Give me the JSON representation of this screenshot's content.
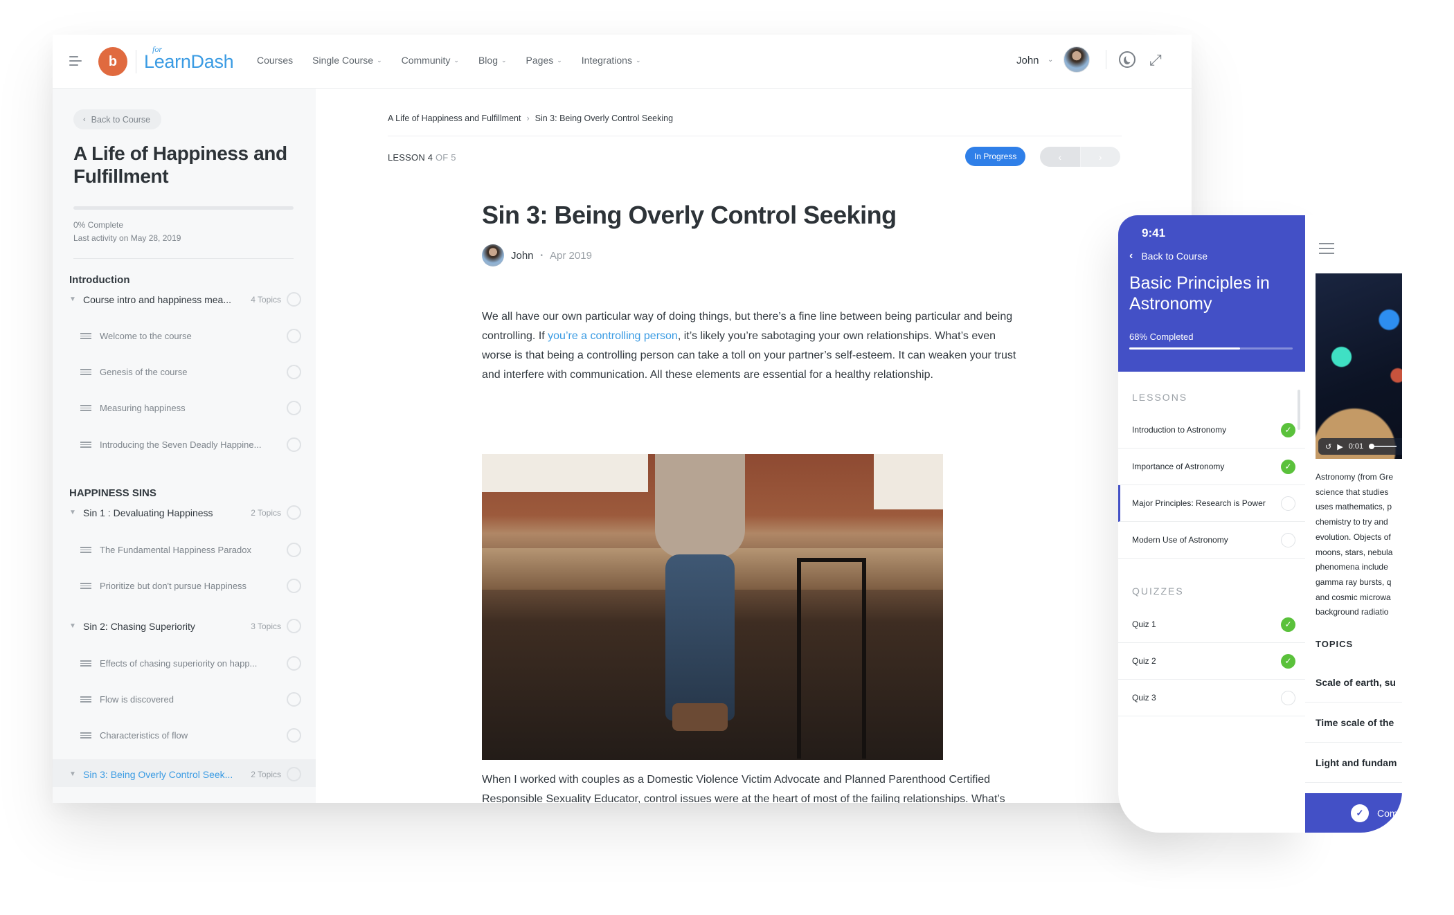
{
  "header": {
    "logo_mark": "b",
    "logo_for": "for",
    "logo_text": "LearnDash",
    "nav": [
      {
        "label": "Courses",
        "dropdown": false
      },
      {
        "label": "Single Course",
        "dropdown": true
      },
      {
        "label": "Community",
        "dropdown": true
      },
      {
        "label": "Blog",
        "dropdown": true
      },
      {
        "label": "Pages",
        "dropdown": true
      },
      {
        "label": "Integrations",
        "dropdown": true
      }
    ],
    "user_name": "John",
    "icons": [
      "menu-icon",
      "chevron-down-icon",
      "avatar",
      "dark-mode-moon-icon",
      "expand-icon"
    ]
  },
  "sidebar": {
    "back_label": "Back to Course",
    "course_title": "A Life of Happiness and Fulfillment",
    "progress_percent": 0,
    "complete_text": "0% Complete",
    "last_activity": "Last activity on May 28, 2019",
    "sections": [
      {
        "title": "Introduction",
        "lessons": [
          {
            "label": "Course intro and happiness mea...",
            "topics_count": "4 Topics",
            "topics": [
              "Welcome to the course",
              "Genesis of the course",
              "Measuring happiness",
              "Introducing the Seven Deadly Happine..."
            ]
          }
        ]
      },
      {
        "title": "HAPPINESS SINS",
        "lessons": [
          {
            "label": "Sin 1 : Devaluating Happiness",
            "topics_count": "2 Topics",
            "topics": [
              "The Fundamental Happiness Paradox",
              "Prioritize but don't pursue Happiness"
            ]
          },
          {
            "label": "Sin 2: Chasing Superiority",
            "topics_count": "3 Topics",
            "topics": [
              "Effects of chasing superiority on happ...",
              "Flow is discovered",
              "Characteristics of flow"
            ]
          },
          {
            "label": "Sin 3: Being Overly Control Seek...",
            "topics_count": "2 Topics",
            "active": true,
            "topics": []
          }
        ]
      }
    ]
  },
  "main": {
    "breadcrumb": [
      "A Life of Happiness and Fulfillment",
      "Sin 3: Being Overly Control Seeking"
    ],
    "breadcrumb_sep": "›",
    "lesson_label": "LESSON 4",
    "lesson_of": "OF 5",
    "status": "In Progress",
    "status_color": "#2f7fe8",
    "prev_label": "‹",
    "next_label": "›",
    "title": "Sin 3: Being Overly Control Seeking",
    "author": "John",
    "date": "Apr 2019",
    "para1_before": "We all have our own particular way of doing things, but there’s a fine line between being particular and being controlling. If ",
    "para1_link": "you’re a controlling person",
    "para1_after": ", it’s likely you’re sabotaging your own relationships. What’s even worse is that being a controlling person can take a toll on your partner’s self-esteem. It can weaken your trust and interfere with communication. All these elements are essential for a healthy relationship.",
    "image_alt": "Woman sitting on a wooden table",
    "para2": "When I worked with couples as a Domestic Violence Victim Advocate and Planned Parenthood Certified Responsible Sexuality Educator, control issues were at the heart of most of the failing relationships. What’s sadder is that control was also a big part of the abusive relationships."
  },
  "phone": {
    "time": "9:41",
    "back_label": "Back to Course",
    "course_title": "Basic Principles in Astronomy",
    "progress_percent": 68,
    "progress_text": "68% Completed",
    "brand_color": "#4350c6",
    "lessons_heading": "LESSONS",
    "lessons": [
      {
        "label": "Introduction to Astronomy",
        "done": true
      },
      {
        "label": "Importance of Astronomy",
        "done": true
      },
      {
        "label": "Major Principles: Research is Power",
        "done": false,
        "current": true
      },
      {
        "label": "Modern Use of Astronomy",
        "done": false
      }
    ],
    "quizzes_heading": "QUIZZES",
    "quizzes": [
      {
        "label": "Quiz 1",
        "done": true
      },
      {
        "label": "Quiz 2",
        "done": true
      },
      {
        "label": "Quiz 3",
        "done": false
      }
    ],
    "video_time": "0:01",
    "content_lines": [
      "Astronomy (from Gre",
      "science that studies",
      "uses mathematics, p",
      "chemistry to try and",
      "evolution. Objects of",
      "moons, stars, nebula",
      "phenomena include",
      "gamma ray bursts, q",
      "and cosmic microwa",
      "background radiatio"
    ],
    "topics_heading": "TOPICS",
    "topics": [
      "Scale of earth, su",
      "Time scale of the",
      "Light and fundam"
    ],
    "complete_label": "Comp"
  }
}
